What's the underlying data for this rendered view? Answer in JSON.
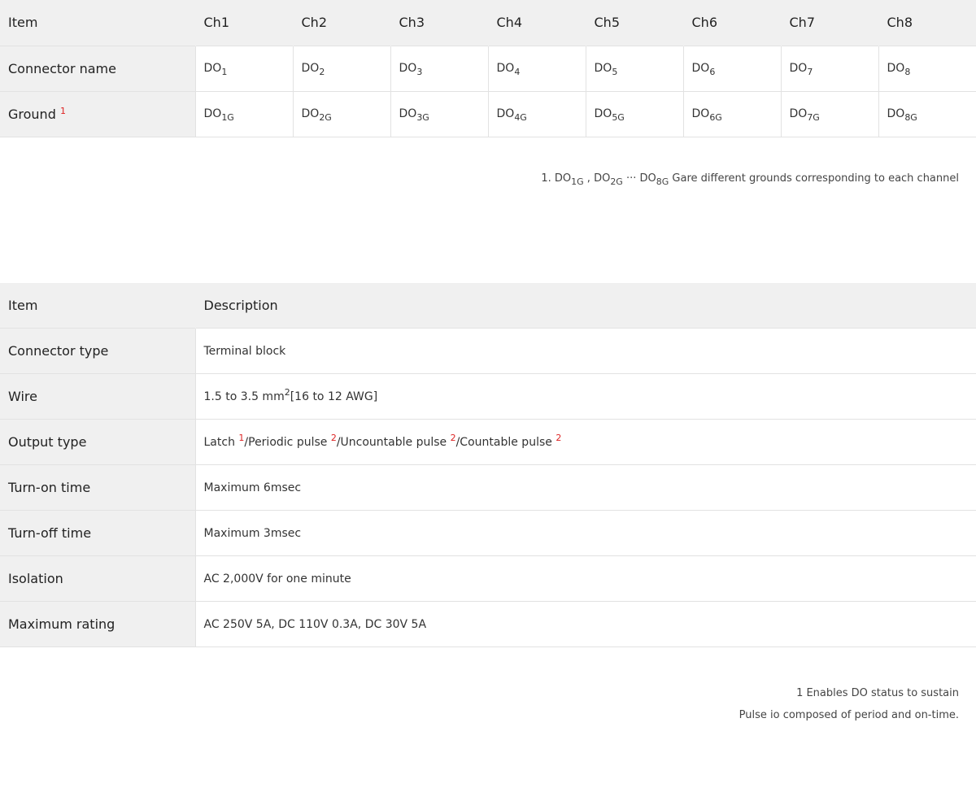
{
  "channel_table": {
    "headers": [
      "Item",
      "Ch1",
      "Ch2",
      "Ch3",
      "Ch4",
      "Ch5",
      "Ch6",
      "Ch7",
      "Ch8"
    ],
    "connector_label": "Connector name",
    "ground_label": "Ground",
    "ground_ref": "1",
    "connector_names": [
      {
        "base": "DO",
        "sub": "1"
      },
      {
        "base": "DO",
        "sub": "2"
      },
      {
        "base": "DO",
        "sub": "3"
      },
      {
        "base": "DO",
        "sub": "4"
      },
      {
        "base": "DO",
        "sub": "5"
      },
      {
        "base": "DO",
        "sub": "6"
      },
      {
        "base": "DO",
        "sub": "7"
      },
      {
        "base": "DO",
        "sub": "8"
      }
    ],
    "grounds": [
      {
        "base": "DO",
        "sub": "1G"
      },
      {
        "base": "DO",
        "sub": "2G"
      },
      {
        "base": "DO",
        "sub": "3G"
      },
      {
        "base": "DO",
        "sub": "4G"
      },
      {
        "base": "DO",
        "sub": "5G"
      },
      {
        "base": "DO",
        "sub": "6G"
      },
      {
        "base": "DO",
        "sub": "7G"
      },
      {
        "base": "DO",
        "sub": "8G"
      }
    ]
  },
  "note1": {
    "prefix": "1. ",
    "a_base": "DO",
    "a_sub": "1G",
    "sep": " , ",
    "b_base": "DO",
    "b_sub": "2G",
    "ellipsis": " ··· ",
    "c_base": "DO",
    "c_sub": "8G",
    "suffix": " Gare different grounds corresponding to each channel"
  },
  "spec_table": {
    "header_item": "Item",
    "header_desc": "Description",
    "connector_type": {
      "label": "Connector type",
      "value": "Terminal block"
    },
    "wire": {
      "label": "Wire",
      "value_pre": "1.5 to 3.5 mm",
      "value_sup": "2",
      "value_post": "[16 to 12 AWG]"
    },
    "output_type": {
      "label": "Output type",
      "latch": "Latch",
      "latch_ref": "1",
      "periodic": "/Periodic pulse",
      "periodic_ref": "2",
      "uncountable": "/Uncountable pulse",
      "uncountable_ref": "2",
      "countable": "/Countable pulse",
      "countable_ref": "2"
    },
    "turn_on": {
      "label": "Turn-on time",
      "value": "Maximum 6msec"
    },
    "turn_off": {
      "label": "Turn-off time",
      "value": "Maximum 3msec"
    },
    "isolation": {
      "label": "Isolation",
      "value": "AC 2,000V for one minute"
    },
    "max_rating": {
      "label": "Maximum rating",
      "value": "AC 250V 5A, DC 110V 0.3A, DC 30V 5A"
    }
  },
  "notes2": [
    "1 Enables DO status to sustain",
    "Pulse io composed of period and on-time."
  ],
  "colors": {
    "header_bg": "#f0f0f0",
    "footnote_ref": "#dd2222",
    "border": "#e2e2e2"
  }
}
